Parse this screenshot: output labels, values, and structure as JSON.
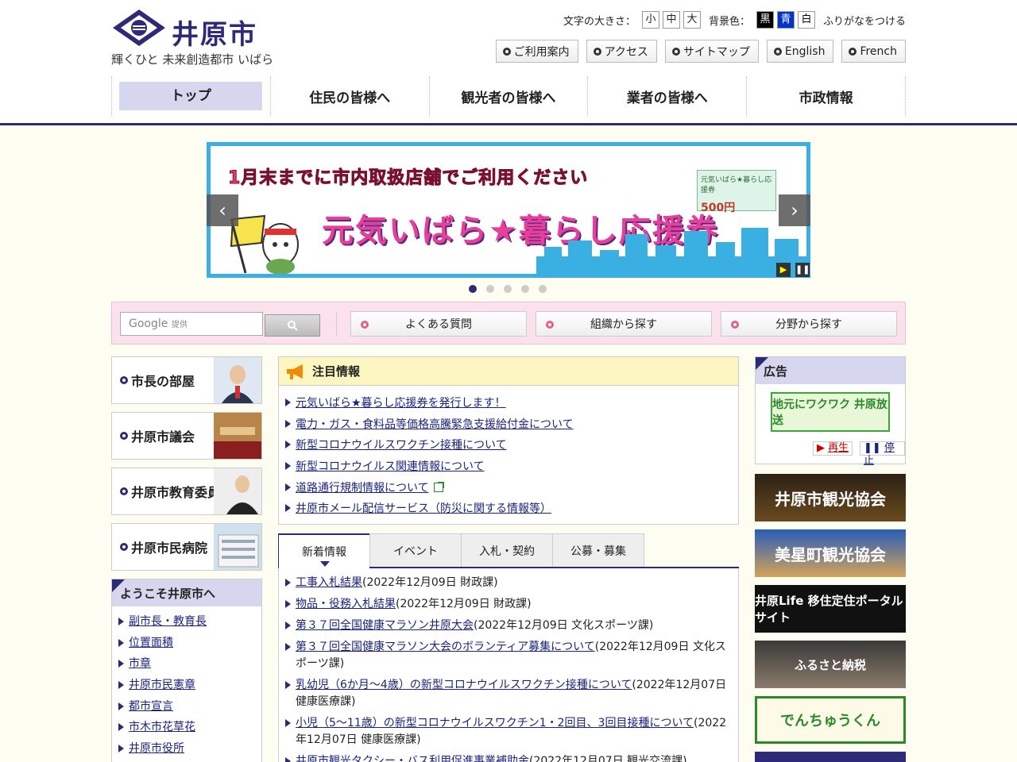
{
  "header": {
    "logo_text": "井原市",
    "logo_subtitle": "輝くひと 未来創造都市 いばら",
    "font_size_label": "文字の大きさ：",
    "font_sizes": [
      "小",
      "中",
      "大"
    ],
    "bg_color_label": "背景色：",
    "bg_colors": [
      "黒",
      "青",
      "白"
    ],
    "furigana": "ふりがなをつける",
    "subnav": [
      "ご利用案内",
      "アクセス",
      "サイトマップ",
      "English",
      "French"
    ],
    "global_nav": [
      "トップ",
      "住民の皆様へ",
      "観光者の皆様へ",
      "業者の皆様へ",
      "市政情報"
    ]
  },
  "banner": {
    "top_text": "1月末までに市内取扱店舗でご利用ください",
    "main_text": "元気いばら★暮らし応援券",
    "ticket_text": "元気いばら★暮らし応援券",
    "ticket_value": "500円",
    "prev": "‹",
    "next": "›",
    "play": "▶",
    "pause": "❚❚"
  },
  "search": {
    "placeholder": "Google 提供",
    "google": "Google",
    "provided": "提供",
    "buttons": [
      "よくある質問",
      "組織から探す",
      "分野から探す"
    ]
  },
  "left": {
    "boxes": [
      "市長の部屋",
      "井原市議会",
      "井原市教育委員会",
      "井原市民病院"
    ],
    "welcome_title": "ようこそ井原市へ",
    "welcome_links": [
      "副市長・教育長",
      "位置面積",
      "市章",
      "井原市民憲章",
      "都市宣言",
      "市木市花草花",
      "井原市役所"
    ]
  },
  "notice": {
    "title": "注目情報",
    "items": [
      "元気いばら★暮らし応援券を発行します！",
      "電力・ガス・食料品等価格高騰緊急支援給付金について",
      "新型コロナウイルスワクチン接種について",
      "新型コロナウイルス関連情報について",
      "道路通行規制情報について",
      "井原市メール配信サービス（防災に関する情報等）"
    ]
  },
  "tabs": [
    "新着情報",
    "イベント",
    "入札・契約",
    "公募・募集"
  ],
  "news": [
    {
      "link": "工事入札結果",
      "meta": "(2022年12月09日 財政課)"
    },
    {
      "link": "物品・役務入札結果",
      "meta": "(2022年12月09日 財政課)"
    },
    {
      "link": "第３７回全国健康マラソン井原大会",
      "meta": "(2022年12月09日 文化スポーツ課)"
    },
    {
      "link": "第３７回全国健康マラソン大会のボランティア募集について",
      "meta": "(2022年12月09日 文化スポーツ課)"
    },
    {
      "link": "乳幼児（6か月～4歳）の新型コロナウイルスワクチン接種について",
      "meta": "(2022年12月07日 健康医療課)"
    },
    {
      "link": "小児（5～11歳）の新型コロナウイルスワクチン1・2回目、3回目接種について",
      "meta": "(2022年12月07日 健康医療課)"
    },
    {
      "link": "井原市観光タクシー・バス利用促進事業補助金",
      "meta": "(2022年12月07日 観光交流課)"
    }
  ],
  "right": {
    "ad_title": "広告",
    "ad_logo": "地元にワクワク 井原放送",
    "play": "再生",
    "stop": "停止",
    "banners": [
      "井原市観光協会",
      "美星町観光協会",
      "井原Life 移住定住ポータルサイト",
      "ふるさと納税",
      "でんちゅうくん"
    ]
  },
  "colors": {
    "brand": "#2d2a78",
    "banner_border": "#3ab0e2",
    "search_bg": "#fbe1ec",
    "notice_head": "#fdf6c0"
  }
}
